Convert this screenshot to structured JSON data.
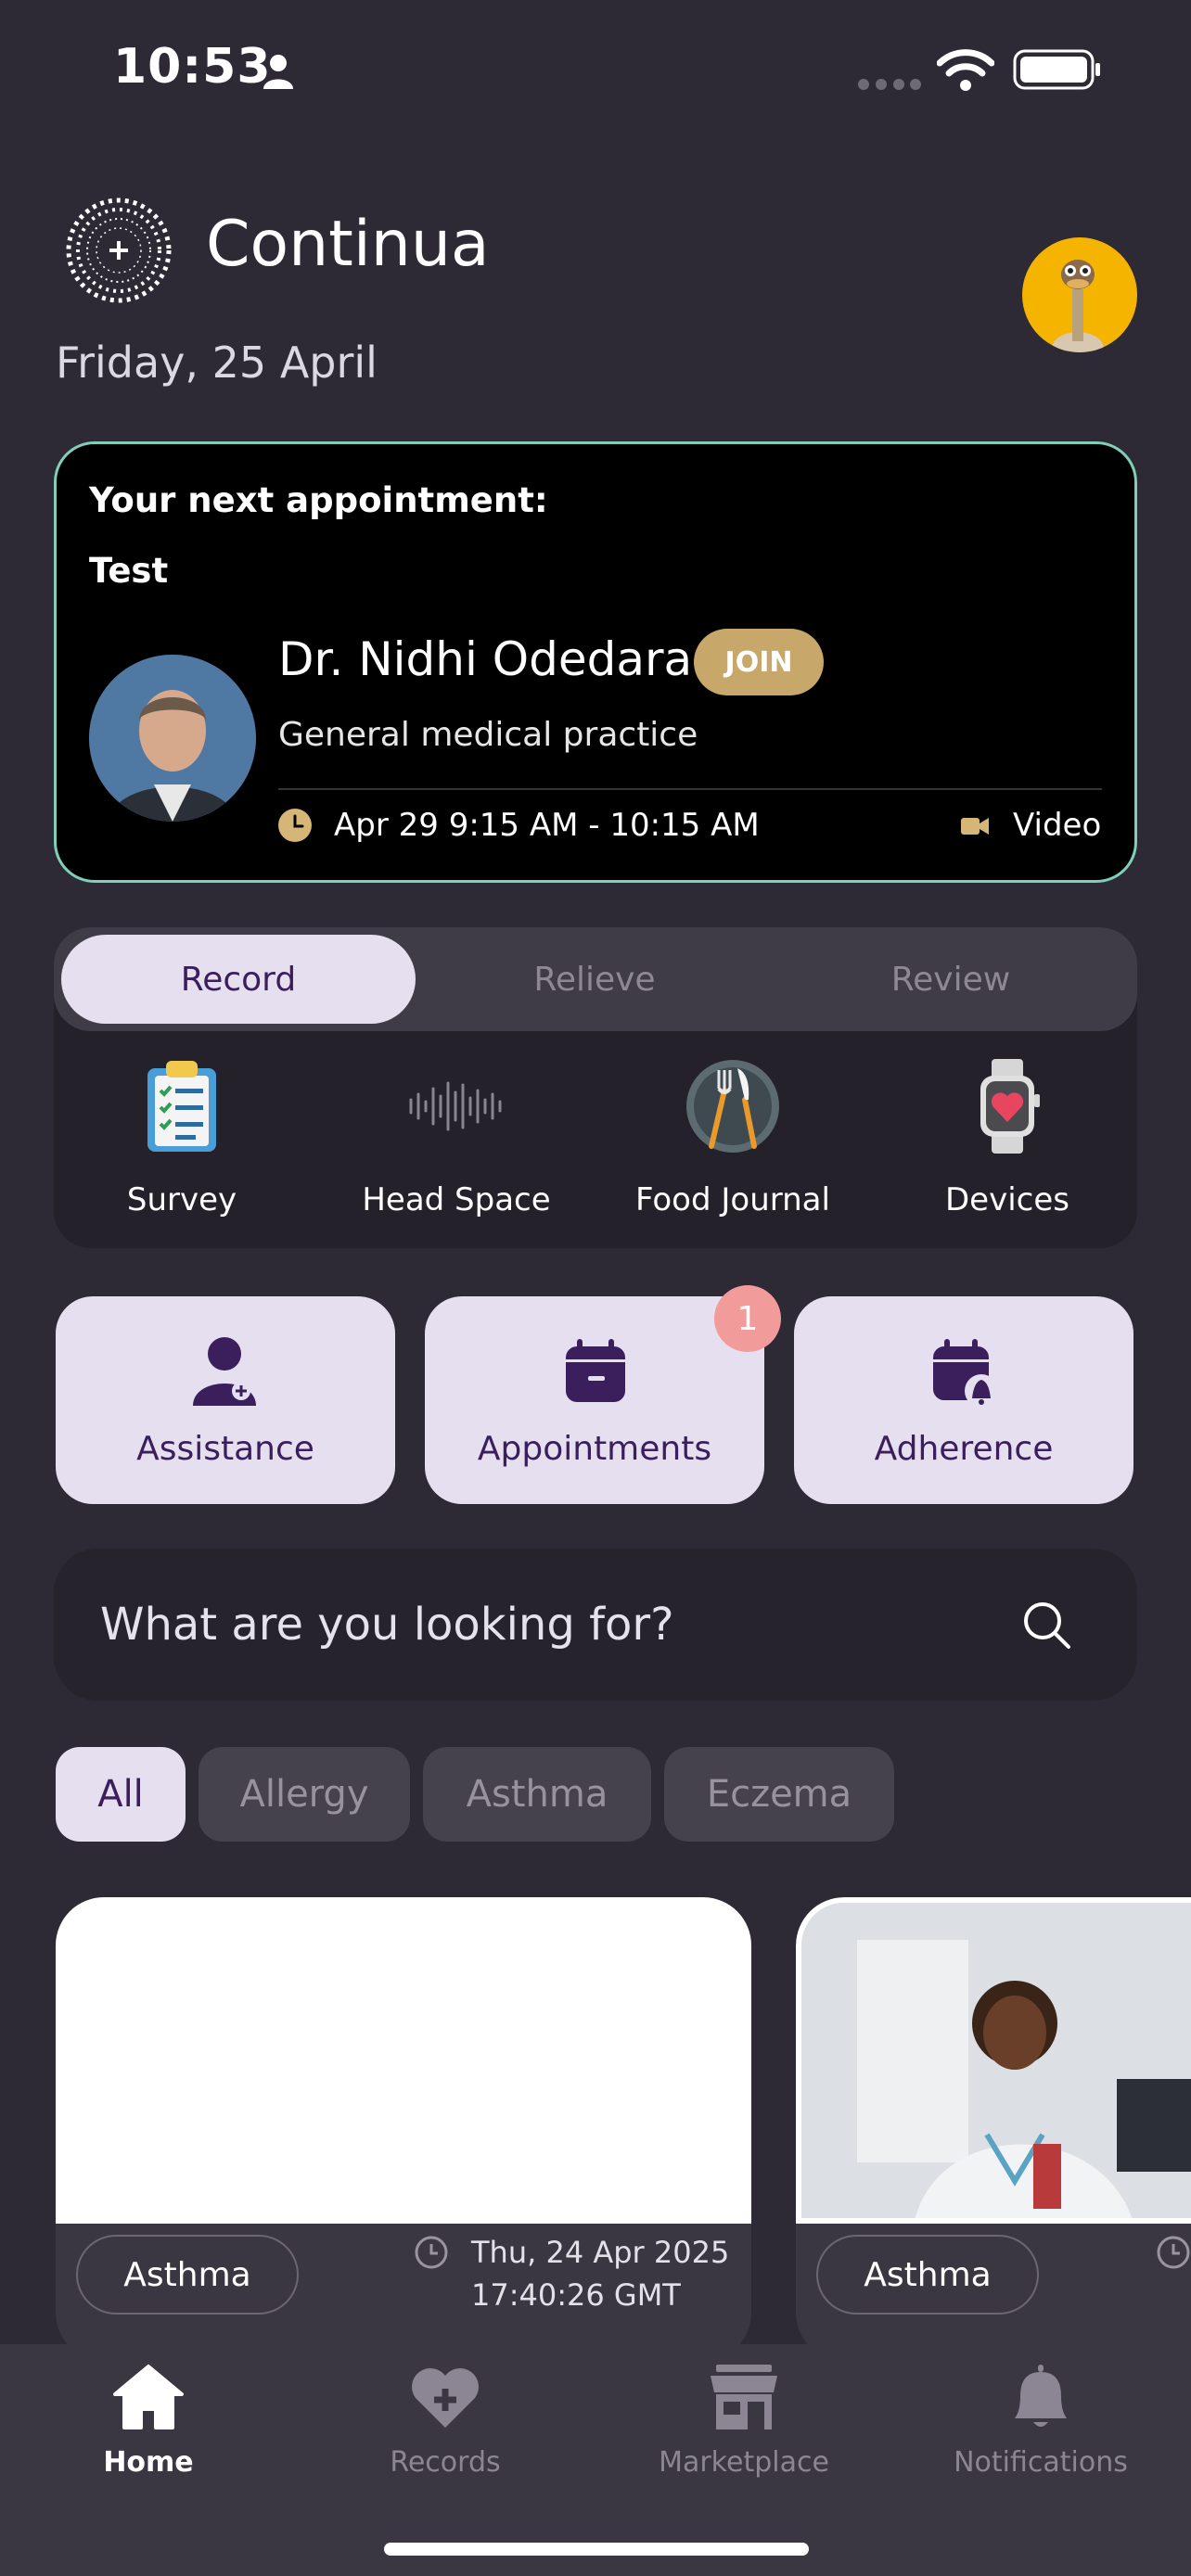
{
  "status_bar": {
    "time": "10:53"
  },
  "header": {
    "brand": "Continua",
    "date": "Friday, 25 April"
  },
  "appointment": {
    "heading": "Your next appointment:",
    "title": "Test",
    "doctor": "Dr. Nidhi Odedara",
    "join_label": "JOIN",
    "specialty": "General medical practice",
    "time": "Apr 29 9:15 AM - 10:15 AM",
    "mode": "Video"
  },
  "tabs": [
    {
      "label": "Record",
      "active": true
    },
    {
      "label": "Relieve",
      "active": false
    },
    {
      "label": "Review",
      "active": false
    }
  ],
  "tools": [
    {
      "label": "Survey",
      "icon": "clipboard-checklist-icon"
    },
    {
      "label": "Head Space",
      "icon": "soundwave-icon"
    },
    {
      "label": "Food Journal",
      "icon": "fork-knife-plate-icon"
    },
    {
      "label": "Devices",
      "icon": "smartwatch-heart-icon"
    }
  ],
  "quick_actions": [
    {
      "label": "Assistance",
      "icon": "user-plus-icon"
    },
    {
      "label": "Appointments",
      "icon": "calendar-icon",
      "badge": "1"
    },
    {
      "label": "Adherence",
      "icon": "calendar-bell-icon"
    }
  ],
  "search": {
    "placeholder": "What are you looking for?"
  },
  "filters": [
    {
      "label": "All",
      "active": true
    },
    {
      "label": "Allergy",
      "active": false
    },
    {
      "label": "Asthma",
      "active": false
    },
    {
      "label": "Eczema",
      "active": false
    }
  ],
  "cards": [
    {
      "tag": "Asthma",
      "date_line1": "Thu, 24 Apr 2025",
      "date_line2": "17:40:26 GMT"
    },
    {
      "tag": "Asthma"
    }
  ],
  "bottom_nav": [
    {
      "label": "Home",
      "icon": "home-icon",
      "active": true
    },
    {
      "label": "Records",
      "icon": "heart-plus-icon",
      "active": false
    },
    {
      "label": "Marketplace",
      "icon": "store-icon",
      "active": false
    },
    {
      "label": "Notifications",
      "icon": "bell-icon",
      "active": false
    }
  ],
  "colors": {
    "background": "#2d2935",
    "accent_light": "#e6dff0",
    "accent_dark": "#3b1f5c",
    "gold": "#c7a86a",
    "card_border": "#7fcfb9",
    "badge": "#f29b9b"
  }
}
